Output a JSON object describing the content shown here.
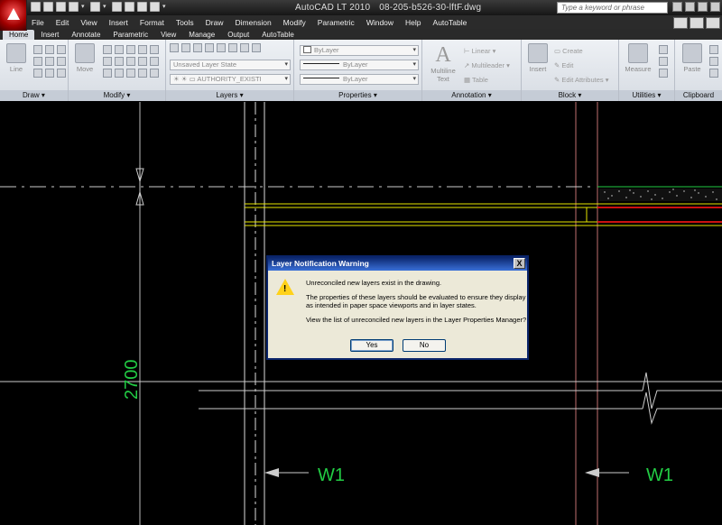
{
  "app": {
    "title": "AutoCAD LT 2010",
    "file_name": "08-205-b526-30-lftF.dwg",
    "search_placeholder": "Type a keyword or phrase"
  },
  "menu": [
    "File",
    "Edit",
    "View",
    "Insert",
    "Format",
    "Tools",
    "Draw",
    "Dimension",
    "Modify",
    "Parametric",
    "Window",
    "Help",
    "AutoTable"
  ],
  "ribbon_tabs": [
    "Home",
    "Insert",
    "Annotate",
    "Parametric",
    "View",
    "Manage",
    "Output",
    "AutoTable"
  ],
  "panels": {
    "draw": {
      "title": "Draw",
      "line_label": "Line"
    },
    "modify": {
      "title": "Modify",
      "move_label": "Move"
    },
    "layers": {
      "title": "Layers",
      "layer_state": "Unsaved Layer State",
      "current_layer": "AUTHORITY_EXISTI"
    },
    "properties": {
      "title": "Properties",
      "color": "ByLayer",
      "linetype": "ByLayer",
      "lineweight": "ByLayer"
    },
    "annotation": {
      "title": "Annotation",
      "mtext_label": "Multiline Text",
      "linear_label": "Linear",
      "multileader_label": "Multileader",
      "table_label": "Table"
    },
    "block": {
      "title": "Block",
      "insert_label": "Insert",
      "create_label": "Create",
      "edit_label": "Edit",
      "edit_attr_label": "Edit Attributes"
    },
    "utilities": {
      "title": "Utilities",
      "measure_label": "Measure"
    },
    "clipboard": {
      "title": "Clipboard",
      "paste_label": "Paste"
    }
  },
  "drawing": {
    "dimension_text": "2700",
    "section_label_left": "W1",
    "section_label_right": "W1",
    "colors": {
      "yellow": "#e6e600",
      "green": "#22cc44",
      "red": "#cc1111",
      "grey": "#cccccc"
    }
  },
  "dialog": {
    "title": "Layer Notification Warning",
    "close_label": "X",
    "line1": "Unreconciled new layers exist in the drawing.",
    "line2": "The properties of these layers should be evaluated to ensure they display as intended in paper space viewports and in layer states.",
    "line3": "View the list of unreconciled new layers in the Layer Properties Manager?",
    "yes_label": "Yes",
    "no_label": "No"
  }
}
